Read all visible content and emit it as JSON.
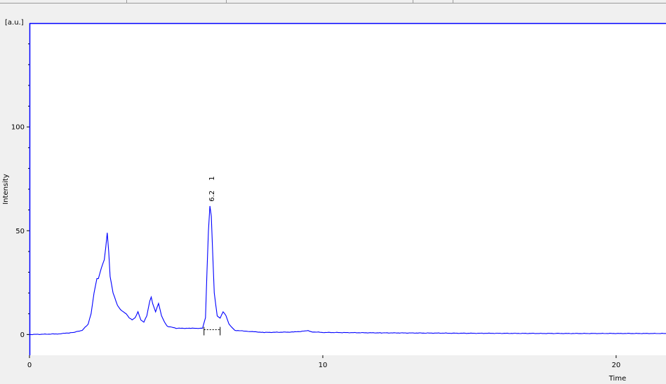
{
  "colors": {
    "trace": "#0000ff",
    "frame": "#0000ff",
    "plot_background": "#ffffff",
    "window_background": "#f0f0f0",
    "text": "#000000"
  },
  "chart_data": {
    "type": "line",
    "title": "",
    "xlabel": "Time",
    "ylabel": "Intensity",
    "y_unit_label": "[a.u.]",
    "xlim": [
      0,
      21.7
    ],
    "ylim": [
      -10,
      150
    ],
    "x_ticks": [
      0,
      10,
      20
    ],
    "y_ticks": [
      0,
      50,
      100
    ],
    "grid": false,
    "legend": "none",
    "series": [
      {
        "x": [
          0,
          1,
          1.5,
          1.8,
          2.0,
          2.1,
          2.2,
          2.3,
          2.35,
          2.45,
          2.55,
          2.6,
          2.65,
          2.7,
          2.75,
          2.85,
          3.0,
          3.1,
          3.2,
          3.3,
          3.4,
          3.5,
          3.6,
          3.7,
          3.8,
          3.9,
          4.0,
          4.1,
          4.15,
          4.2,
          4.3,
          4.4,
          4.5,
          4.6,
          4.7,
          5.0,
          5.5,
          5.9,
          6.0,
          6.05,
          6.1,
          6.15,
          6.2,
          6.25,
          6.3,
          6.4,
          6.5,
          6.6,
          6.7,
          6.8,
          7.0,
          7.5,
          8.0,
          9.0,
          9.5,
          9.6,
          10.0,
          12.0,
          15.0,
          18.0,
          21.7
        ],
        "y": [
          0,
          0.3,
          1,
          2,
          5,
          10,
          20,
          27,
          27,
          32,
          36,
          42,
          49,
          40,
          28,
          20,
          14,
          12,
          11,
          10,
          8,
          7,
          8,
          11,
          7,
          6,
          9,
          16,
          18,
          15,
          11,
          15,
          9,
          6,
          4,
          3,
          3,
          3,
          8,
          30,
          50,
          62,
          57,
          38,
          20,
          9,
          8,
          11,
          9,
          5,
          2,
          1.5,
          1,
          1.2,
          1.8,
          1.3,
          1,
          0.8,
          0.6,
          0.5,
          0.5
        ]
      }
    ],
    "peaks": [
      {
        "number": "1",
        "time_label": "6.2",
        "time": 6.2,
        "height": 62,
        "baseline_start": 5.95,
        "baseline_end": 6.5
      }
    ]
  }
}
